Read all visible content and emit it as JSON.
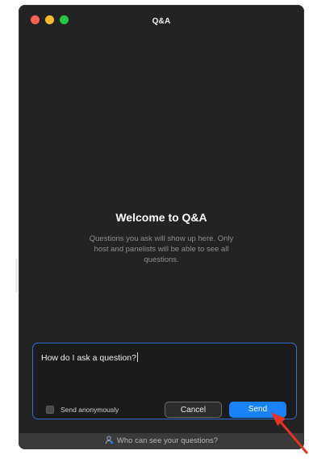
{
  "window": {
    "title": "Q&A"
  },
  "welcome": {
    "title": "Welcome to Q&A",
    "description": "Questions you ask will show up here. Only host and panelists will be able to see all questions."
  },
  "composer": {
    "question_value": "How do I ask a question?",
    "anonymous_label": "Send anonymously",
    "anonymous_checked": false,
    "cancel_label": "Cancel",
    "send_label": "Send"
  },
  "footer": {
    "visibility_link": "Who can see your questions?",
    "icon": "person-icon"
  },
  "colors": {
    "window_bg": "#232323",
    "accent": "#1a82f7",
    "annotation_arrow": "#e53221"
  }
}
